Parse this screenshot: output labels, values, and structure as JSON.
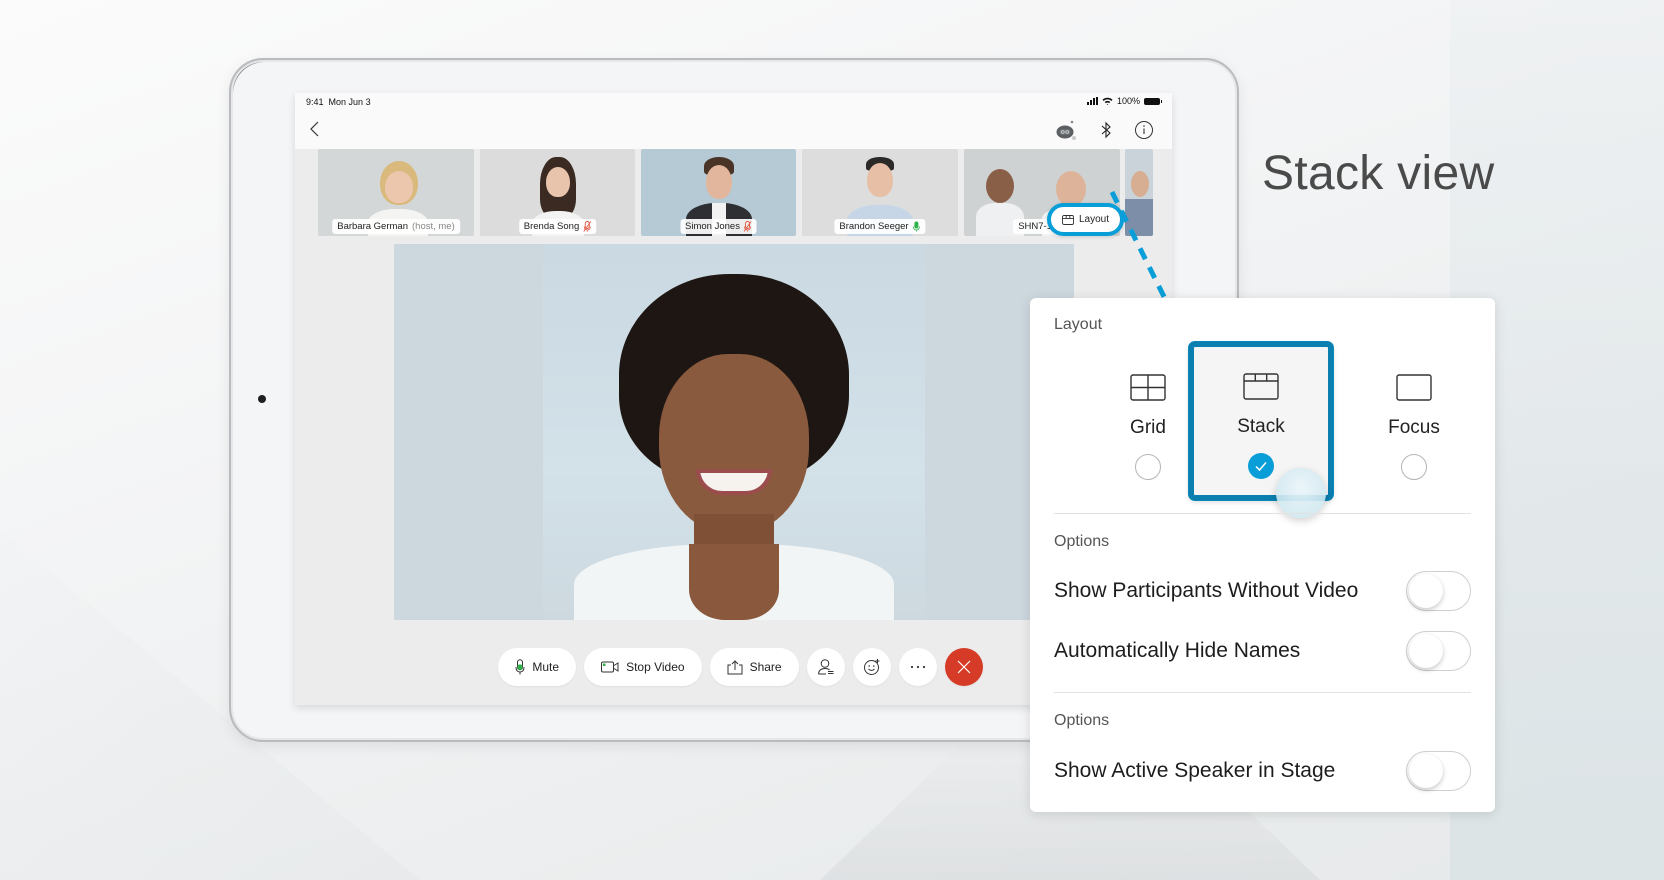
{
  "headline": "Stack view",
  "status_bar": {
    "time": "9:41",
    "date": "Mon Jun 3",
    "battery": "100%"
  },
  "nav": {
    "back_icon": "chevron-left-icon",
    "icons": [
      "assistant-bot-icon",
      "bluetooth-icon",
      "info-icon"
    ]
  },
  "layout_button": {
    "label": "Layout",
    "icon": "layout-icon",
    "highlight_color": "#0a9ed8"
  },
  "participants": [
    {
      "name": "Barbara German",
      "role": "(host, me)",
      "mic": "none"
    },
    {
      "name": "Brenda Song",
      "role": "",
      "mic": "muted"
    },
    {
      "name": "Simon Jones",
      "role": "",
      "mic": "muted"
    },
    {
      "name": "Brandon Seeger",
      "role": "",
      "mic": "active"
    },
    {
      "name": "SHN7-16-BIG BEN",
      "role": "",
      "mic": "muted"
    }
  ],
  "controls": {
    "mute": "Mute",
    "stop_video": "Stop Video",
    "share": "Share",
    "participants_icon": "participants-icon",
    "reactions_icon": "emoji-icon",
    "more_icon": "more-icon",
    "end_icon": "end-call-icon",
    "end_color": "#d63b27"
  },
  "layout_panel": {
    "title": "Layout",
    "options": [
      {
        "label": "Grid",
        "icon": "grid-layout-icon",
        "selected": false
      },
      {
        "label": "Stack",
        "icon": "stack-layout-icon",
        "selected": true
      },
      {
        "label": "Focus",
        "icon": "focus-layout-icon",
        "selected": false
      }
    ],
    "options_section_1": {
      "title": "Options",
      "rows": [
        {
          "label": "Show Participants Without Video",
          "on": false
        },
        {
          "label": "Automatically Hide Names",
          "on": false
        }
      ]
    },
    "options_section_2": {
      "title": "Options",
      "rows": [
        {
          "label": "Show Active Speaker in Stage",
          "on": false
        }
      ]
    },
    "accent": "#0a9ed8"
  }
}
